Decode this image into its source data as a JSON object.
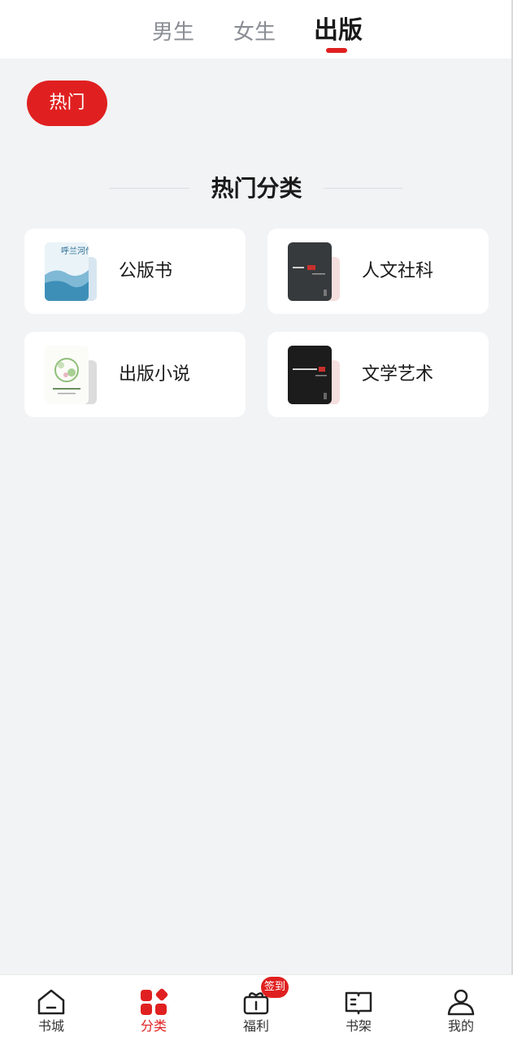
{
  "tabs": [
    {
      "label": "男生",
      "active": false
    },
    {
      "label": "女生",
      "active": false
    },
    {
      "label": "出版",
      "active": true
    }
  ],
  "filter_chip": {
    "label": "热门"
  },
  "section": {
    "title": "热门分类"
  },
  "categories": [
    {
      "label": "公版书",
      "cover": "light-blue-landscape-cover",
      "cover_title": "呼兰河传"
    },
    {
      "label": "人文社科",
      "cover": "dark-grey-cover"
    },
    {
      "label": "出版小说",
      "cover": "white-floral-cover"
    },
    {
      "label": "文学艺术",
      "cover": "black-cover"
    }
  ],
  "bottom_nav": [
    {
      "label": "书城",
      "icon": "home-icon",
      "active": false
    },
    {
      "label": "分类",
      "icon": "category-grid-icon",
      "active": true
    },
    {
      "label": "福利",
      "icon": "gift-icon",
      "active": false,
      "badge": "签到"
    },
    {
      "label": "书架",
      "icon": "open-book-icon",
      "active": false
    },
    {
      "label": "我的",
      "icon": "user-icon",
      "active": false
    }
  ],
  "colors": {
    "accent": "#e02020",
    "background": "#f2f3f5",
    "card": "#ffffff"
  }
}
